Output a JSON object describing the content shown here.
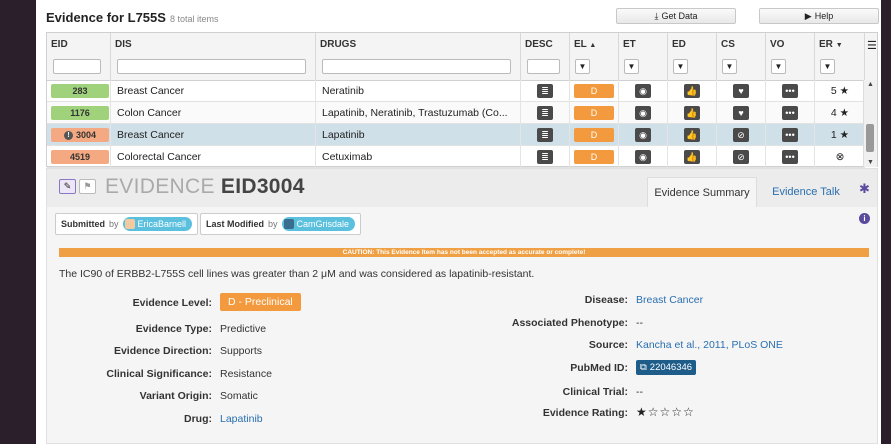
{
  "page": {
    "title": "Evidence for L755S",
    "count": "8 total items",
    "get_data": "Get Data",
    "help": "Help"
  },
  "columns": [
    "EID",
    "DIS",
    "DRUGS",
    "DESC",
    "EL",
    "ET",
    "ED",
    "CS",
    "VO",
    "ER"
  ],
  "sort": {
    "el": "▲",
    "er": "▼"
  },
  "rows": [
    {
      "eid": "283",
      "eid_color": "#9fd27b",
      "dis": "Breast Cancer",
      "drugs": "Neratinib",
      "el": "D",
      "cs_icon": "heart-icon",
      "er": "5"
    },
    {
      "eid": "1176",
      "eid_color": "#9fd27b",
      "dis": "Colon Cancer",
      "drugs": "Lapatinib, Neratinib, Trastuzumab (Co...",
      "el": "D",
      "cs_icon": "heart-icon",
      "er": "4"
    },
    {
      "eid": "3004",
      "eid_color": "#f5a983",
      "dis": "Breast Cancer",
      "drugs": "Lapatinib",
      "el": "D",
      "cs_icon": "ban-icon",
      "er": "1"
    },
    {
      "eid": "4519",
      "eid_color": "#f5a983",
      "dis": "Colorectal Cancer",
      "drugs": "Cetuximab",
      "el": "D",
      "cs_icon": "ban-icon",
      "er": "⊗"
    }
  ],
  "detail": {
    "title_prefix": "EVIDENCE",
    "title_id": "EID3004",
    "tabs": [
      "Evidence Summary",
      "Evidence Talk"
    ],
    "submitted_label": "Submitted",
    "by": "by",
    "submitted_user": "EricaBarnell",
    "modified_label": "Last Modified",
    "modified_user": "CamGrisdale",
    "caution": "CAUTION: This Evidence Item has not been accepted as accurate or complete!",
    "statement": "The IC90 of ERBB2-L755S cell lines was greater than 2 μM and was considered as lapatinib-resistant.",
    "left_fields": [
      {
        "label": "Evidence Level:",
        "value": "D - Preclinical"
      },
      {
        "label": "Evidence Type:",
        "value": "Predictive"
      },
      {
        "label": "Evidence Direction:",
        "value": "Supports"
      },
      {
        "label": "Clinical Significance:",
        "value": "Resistance"
      },
      {
        "label": "Variant Origin:",
        "value": "Somatic"
      },
      {
        "label": "Drug:",
        "value": "Lapatinib"
      }
    ],
    "right_fields": [
      {
        "label": "Disease:",
        "value": "Breast Cancer"
      },
      {
        "label": "Associated Phenotype:",
        "value": "--"
      },
      {
        "label": "Source:",
        "value": "Kancha et al., 2011, PLoS ONE"
      },
      {
        "label": "PubMed ID:",
        "value": "22046346"
      },
      {
        "label": "Clinical Trial:",
        "value": "--"
      },
      {
        "label": "Evidence Rating:",
        "value": "★☆☆☆☆"
      }
    ]
  },
  "colors": {
    "accent_orange": "#f39a3e",
    "link_blue": "#2a6fb0",
    "selected_row": "#cfe0e8",
    "user_pill": "#5bc0de"
  }
}
